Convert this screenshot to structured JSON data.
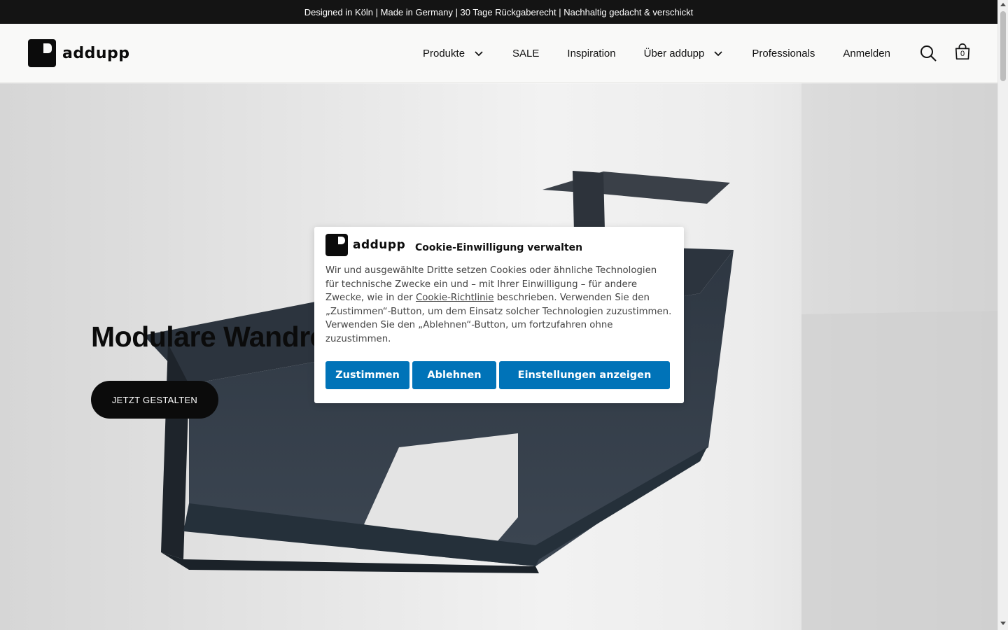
{
  "announcement": "Designed in Köln | Made in Germany | 30 Tage Rückgaberecht | Nachhaltig gedacht & verschickt",
  "header": {
    "logo_text": "addupp",
    "nav": [
      {
        "label": "Produkte",
        "has_dropdown": true
      },
      {
        "label": "SALE",
        "has_dropdown": false
      },
      {
        "label": "Inspiration",
        "has_dropdown": false
      },
      {
        "label": "Über addupp",
        "has_dropdown": true
      },
      {
        "label": "Professionals",
        "has_dropdown": false
      },
      {
        "label": "Anmelden",
        "has_dropdown": false
      }
    ],
    "icons": [
      "search-icon",
      "cart-icon"
    ],
    "cart_count": "0"
  },
  "hero": {
    "title": "Modulare Wandre",
    "cta_label": "JETZT GESTALTEN"
  },
  "cookie_dialog": {
    "logo_text": "addupp",
    "title": "Cookie-Einwilligung verwalten",
    "text_before_link": "Wir und ausgewählte Dritte setzen Cookies oder ähnliche Technologien für technische Zwecke ein und – mit Ihrer Einwilligung – für andere Zwecke, wie in der ",
    "link_text": "Cookie-Richtlinie",
    "text_after_link": " beschrieben. Verwenden Sie den „Zustimmen“-Button, um dem Einsatz solcher Technologien zuzustimmen. Verwenden Sie den „Ablehnen“-Button, um fortzufahren ohne zuzustimmen.",
    "accept_label": "Zustimmen",
    "reject_label": "Ablehnen",
    "settings_label": "Einstellungen anzeigen",
    "button_color": "#0073b8"
  },
  "colors": {
    "announcement_bg": "#141414",
    "header_bg": "#f9f9f8",
    "primary_button_bg": "#0b0b0b"
  }
}
